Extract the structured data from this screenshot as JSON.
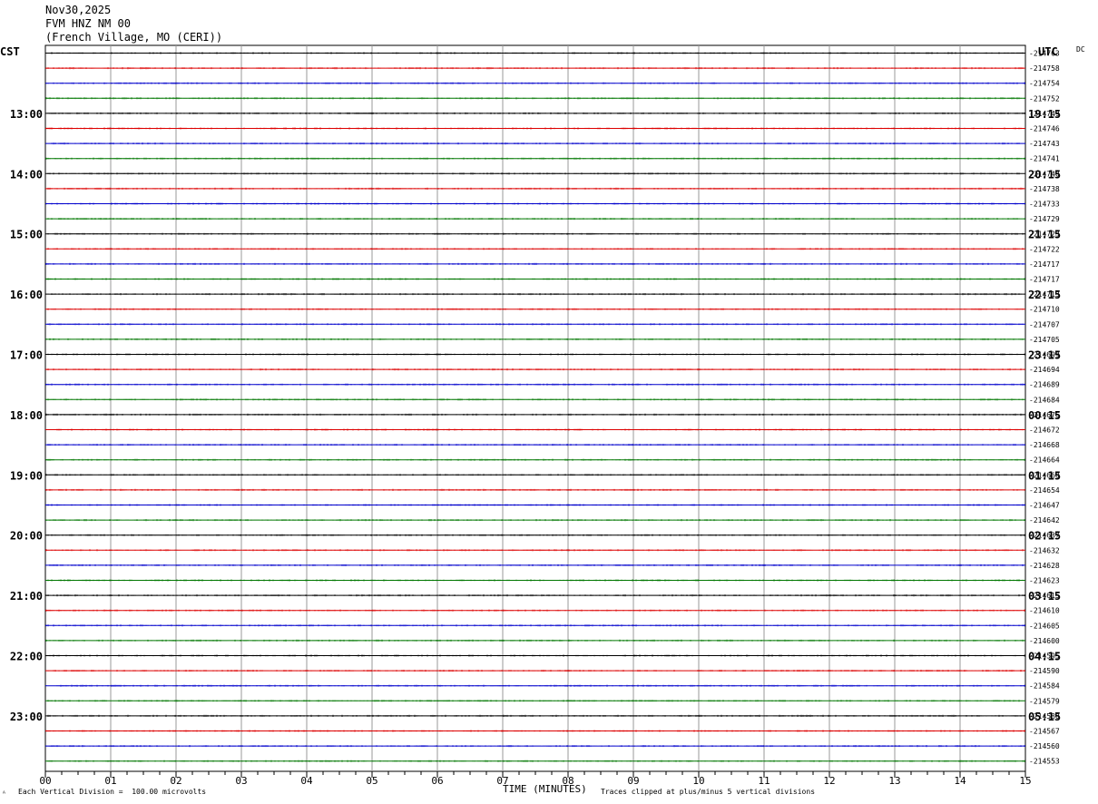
{
  "header": {
    "date": "Nov30,2025",
    "station": "FVM HNZ NM 00",
    "location": "(French Village, MO (CERI))"
  },
  "chart_data": {
    "type": "line",
    "left_tz": "CST",
    "right_tz": "UTC",
    "dc_label": "DC",
    "xlabel": "TIME (MINUTES)",
    "x_ticks": [
      "00",
      "01",
      "02",
      "03",
      "04",
      "05",
      "06",
      "07",
      "08",
      "09",
      "10",
      "11",
      "12",
      "13",
      "14",
      "15"
    ],
    "xlim": [
      0,
      15
    ],
    "trace_colors": [
      "#000000",
      "#dd0000",
      "#0000cc",
      "#007700"
    ],
    "hour_labels_left": [
      "13:00",
      "14:00",
      "15:00",
      "16:00",
      "17:00",
      "18:00",
      "19:00",
      "20:00",
      "21:00",
      "22:00",
      "23:00"
    ],
    "hour_labels_right": [
      "19:15",
      "20:15",
      "21:15",
      "22:15",
      "23:15",
      "00:15",
      "01:15",
      "02:15",
      "03:15",
      "04:15",
      "05:15"
    ],
    "dc_offsets": [
      "-214763",
      "-214758",
      "-214754",
      "-214752",
      "-214749",
      "-214746",
      "-214743",
      "-214741",
      "-214740",
      "-214738",
      "-214733",
      "-214729",
      "-214723",
      "-214722",
      "-214717",
      "-214717",
      "-214713",
      "-214710",
      "-214707",
      "-214705",
      "-214699",
      "-214694",
      "-214689",
      "-214684",
      "-214676",
      "-214672",
      "-214668",
      "-214664",
      "-214660",
      "-214654",
      "-214647",
      "-214642",
      "-214637",
      "-214632",
      "-214628",
      "-214623",
      "-214615",
      "-214610",
      "-214605",
      "-214600",
      "-214595",
      "-214590",
      "-214584",
      "-214579",
      "-214580",
      "-214567",
      "-214560",
      "-214553"
    ]
  },
  "footer": {
    "scale_note": "Each Vertical Division =  100.00 microvolts",
    "clip_note": "Traces clipped at plus/minus 5 vertical divisions",
    "corner_mark": "ᴬ"
  }
}
